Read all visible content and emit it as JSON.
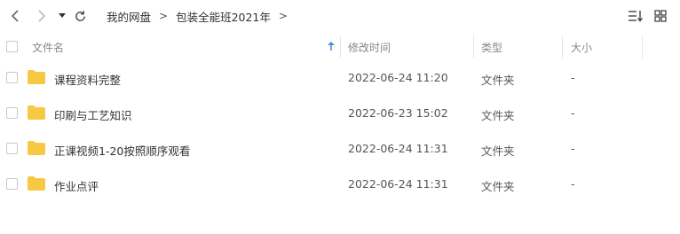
{
  "breadcrumb": {
    "items": [
      "我的网盘",
      "包装全能班2021年"
    ],
    "separator": ">"
  },
  "header": {
    "name": "文件名",
    "modified": "修改时间",
    "type": "类型",
    "size": "大小",
    "sort_icon": "sort-up-arrow-icon"
  },
  "files": [
    {
      "name": "课程资料完整",
      "modified": "2022-06-24 11:20",
      "type": "文件夹",
      "size": "-"
    },
    {
      "name": "印刷与工艺知识",
      "modified": "2022-06-23 15:02",
      "type": "文件夹",
      "size": "-"
    },
    {
      "name": "正课视频1-20按照顺序观看",
      "modified": "2022-06-24 11:31",
      "type": "文件夹",
      "size": "-"
    },
    {
      "name": "作业点评",
      "modified": "2022-06-24 11:31",
      "type": "文件夹",
      "size": "-"
    }
  ],
  "colors": {
    "folder": "#f7c843",
    "sort_arrow": "#4a90d9",
    "divider": "#e6e6e6"
  }
}
